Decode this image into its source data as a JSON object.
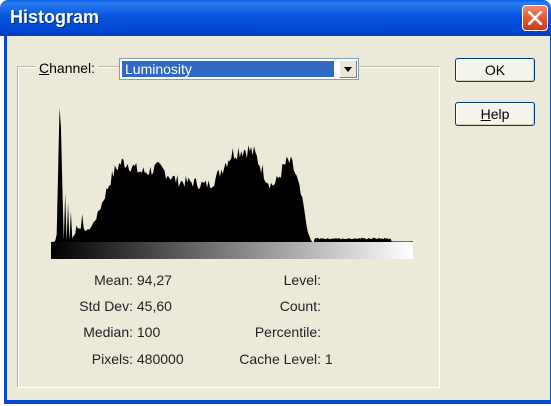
{
  "window": {
    "title": "Histogram"
  },
  "channel": {
    "label_prefix": "",
    "label_accel": "C",
    "label_rest": "hannel:",
    "value": "Luminosity"
  },
  "buttons": {
    "ok": "OK",
    "help_accel": "H",
    "help_rest": "elp"
  },
  "stats_left": [
    {
      "label": "Mean:",
      "value": "94,27"
    },
    {
      "label": "Std Dev:",
      "value": "45,60"
    },
    {
      "label": "Median:",
      "value": "100"
    },
    {
      "label": "Pixels:",
      "value": "480000"
    }
  ],
  "stats_right": [
    {
      "label": "Level:",
      "value": ""
    },
    {
      "label": "Count:",
      "value": ""
    },
    {
      "label": "Percentile:",
      "value": ""
    },
    {
      "label": "Cache Level:",
      "value": "1"
    }
  ],
  "histogram": {
    "bins": 256,
    "fill_color": "#000000",
    "peaks": [
      {
        "level": 6,
        "rel_height": 0.96
      },
      {
        "level": 22,
        "rel_height": 0.48
      },
      {
        "level": 50,
        "rel_height": 0.6
      },
      {
        "level": 100,
        "rel_height": 0.46
      },
      {
        "level": 135,
        "rel_height": 0.55
      },
      {
        "level": 168,
        "rel_height": 0.65
      }
    ],
    "fade_out_level": 160,
    "near_zero_end_level": 240
  }
}
